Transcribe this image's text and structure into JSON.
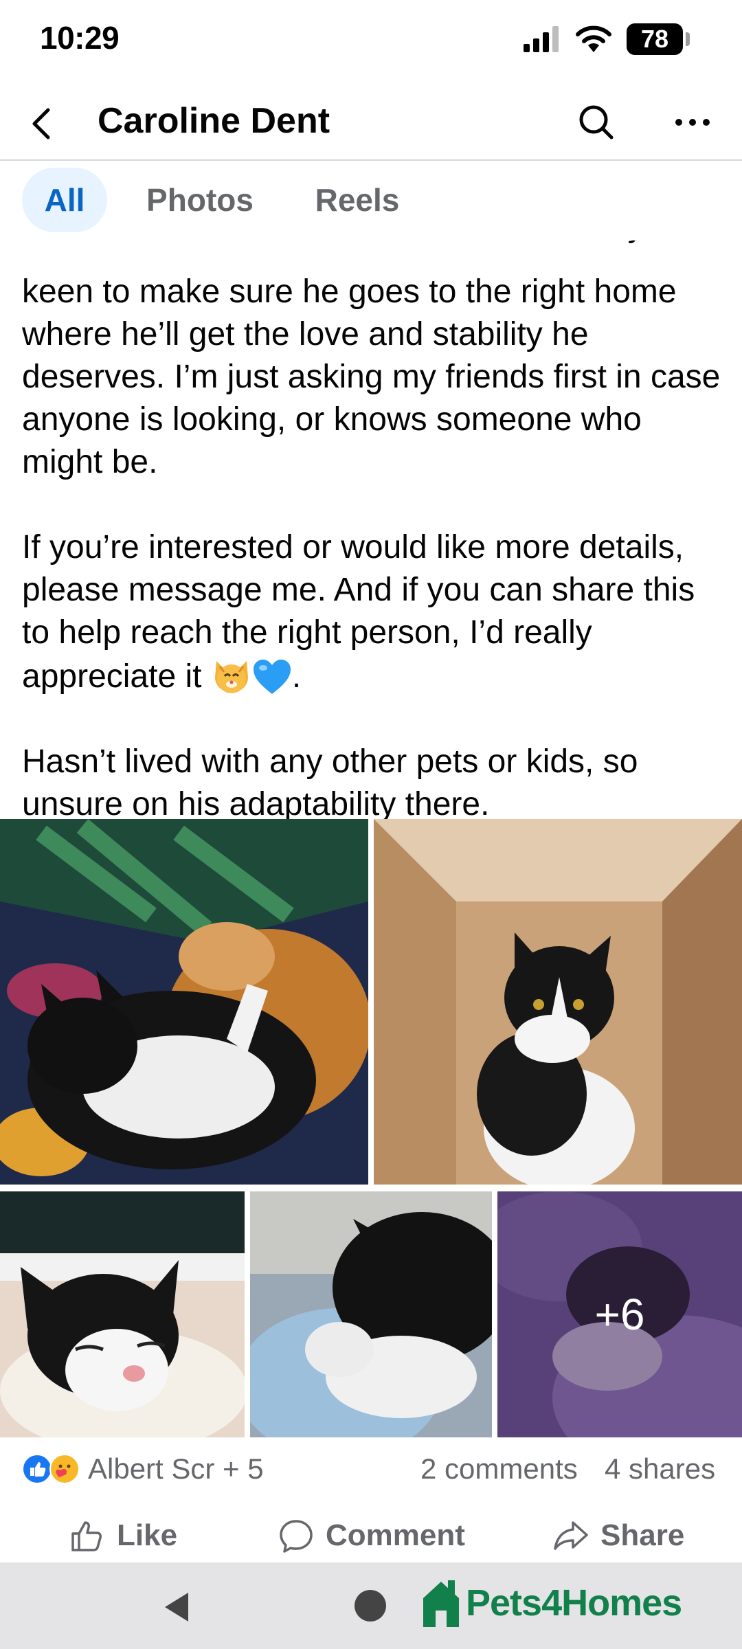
{
  "status_bar": {
    "time": "10:29",
    "battery": "78",
    "icons": [
      "signal-icon",
      "wifi-icon",
      "battery-icon"
    ]
  },
  "header": {
    "title": "Caroline Dent",
    "back_icon": "back-arrow-icon",
    "search_icon": "search-icon",
    "more_icon": "more-dots-icon"
  },
  "tabs": [
    {
      "label": "All",
      "active": true
    },
    {
      "label": "Photos",
      "active": false
    },
    {
      "label": "Reels",
      "active": false
    }
  ],
  "post": {
    "cut_line": "This is not a rushed decision and I'm really",
    "paragraph_1": "keen to make sure he goes to the right home where he’ll get the love and stability he deserves. I’m just asking my friends first in case anyone is looking, or knows someone who might be.",
    "paragraph_2": "If you’re interested or would like more details, please message me. And if you can share this to help reach the right person, I’d really appreciate it",
    "paragraph_2_end": ".",
    "paragraph_3": "Hasn’t lived with any other pets or kids, so unsure on his adaptability there.",
    "emojis": [
      "cat-face-emoji",
      "blue-heart-emoji"
    ]
  },
  "photos": {
    "more_count": "+6"
  },
  "reactions": {
    "names": "Albert Scr + 5",
    "comments": "2 comments",
    "shares": "4 shares",
    "icons": [
      "like-reaction-icon",
      "care-reaction-icon"
    ]
  },
  "actions": {
    "like": "Like",
    "comment": "Comment",
    "share": "Share"
  },
  "nav": {
    "watermark": "Pets4Homes"
  },
  "colors": {
    "accent": "#0a66c2",
    "tab_active_bg": "#e7f3ff",
    "secondary_text": "#65676b",
    "watermark_green": "#11804a"
  }
}
